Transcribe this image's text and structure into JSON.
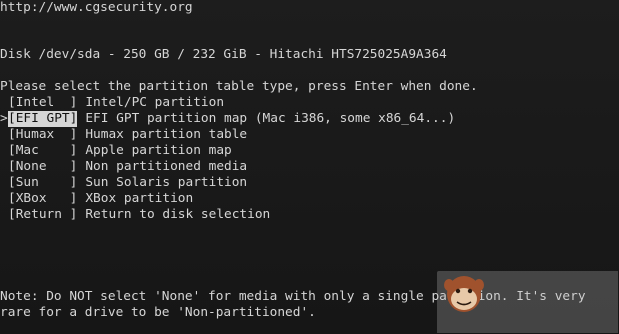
{
  "url": "http://www.cgsecurity.org",
  "disk": "Disk /dev/sda - 250 GB / 232 GiB - Hitachi HTS725025A9A364",
  "prompt": "Please select the partition table type, press Enter when done.",
  "options": [
    {
      "code": "[Intel  ]",
      "desc": "Intel/PC partition",
      "selected": false
    },
    {
      "code": "[EFI GPT]",
      "desc": "EFI GPT partition map (Mac i386, some x86_64...)",
      "selected": true
    },
    {
      "code": "[Humax  ]",
      "desc": "Humax partition table",
      "selected": false
    },
    {
      "code": "[Mac    ]",
      "desc": "Apple partition map",
      "selected": false
    },
    {
      "code": "[None   ]",
      "desc": "Non partitioned media",
      "selected": false
    },
    {
      "code": "[Sun    ]",
      "desc": "Sun Solaris partition",
      "selected": false
    },
    {
      "code": "[XBox   ]",
      "desc": "XBox partition",
      "selected": false
    },
    {
      "code": "[Return ]",
      "desc": "Return to disk selection",
      "selected": false
    }
  ],
  "selection_marker": ">",
  "note_line1": "Note: Do NOT select 'None' for media with only a single partition. It's very",
  "note_line2": "rare for a drive to be 'Non-partitioned'.",
  "colors": {
    "background": "#1a1a1a",
    "text": "#d6d6d6",
    "highlight_bg": "#d6d6d6",
    "highlight_text": "#111111"
  },
  "watermark_icon": "monkey-face-icon"
}
